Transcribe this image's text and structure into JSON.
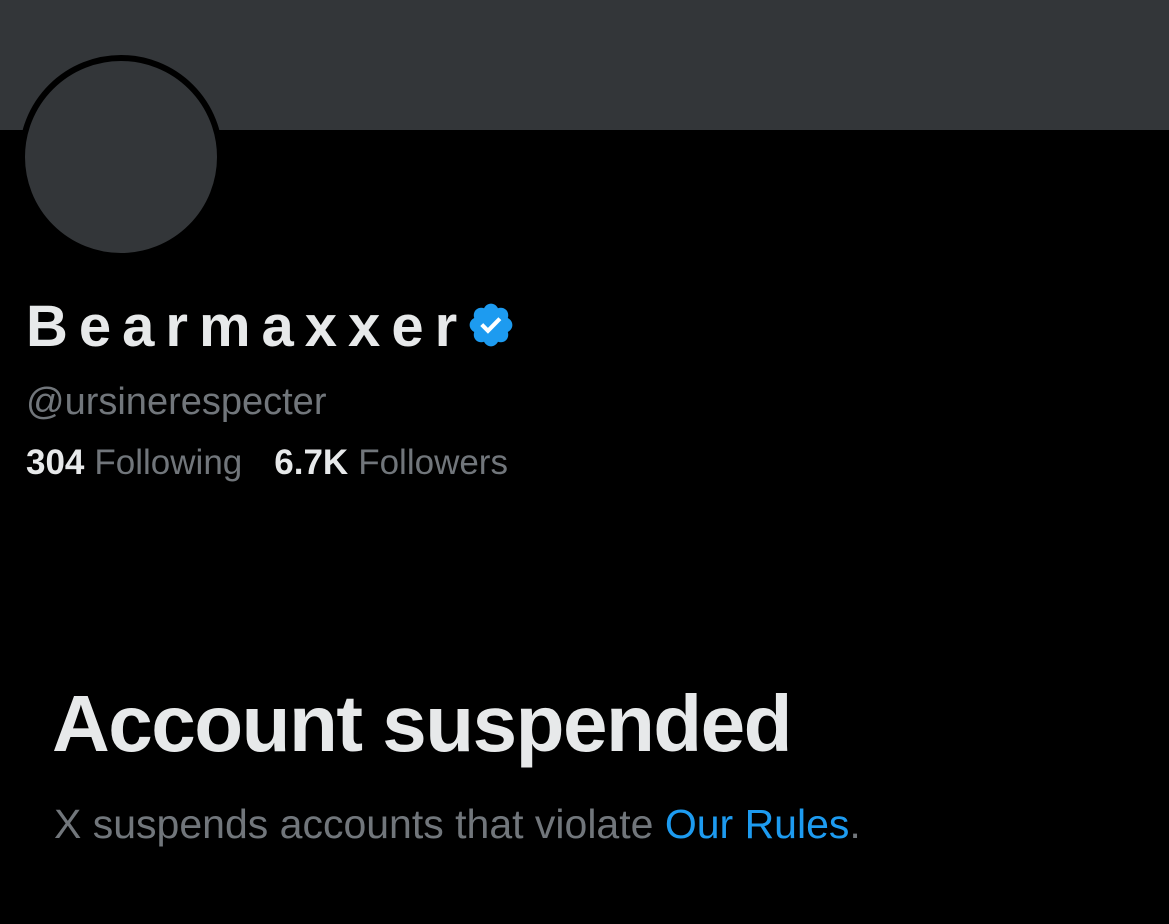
{
  "profile": {
    "display_name": "Bearmaxxer",
    "handle": "@ursinerespecter",
    "verified": true,
    "verified_icon": "verified-badge-icon",
    "following_count": "304",
    "following_label": "Following",
    "followers_count": "6.7K",
    "followers_label": "Followers"
  },
  "suspension": {
    "title": "Account suspended",
    "description_prefix": "X suspends accounts that violate ",
    "rules_link_text": "Our Rules",
    "description_suffix": "."
  },
  "colors": {
    "background": "#000000",
    "banner": "#333639",
    "primary_text": "#e7e9ea",
    "secondary_text": "#71767b",
    "accent": "#1d9bf0"
  }
}
